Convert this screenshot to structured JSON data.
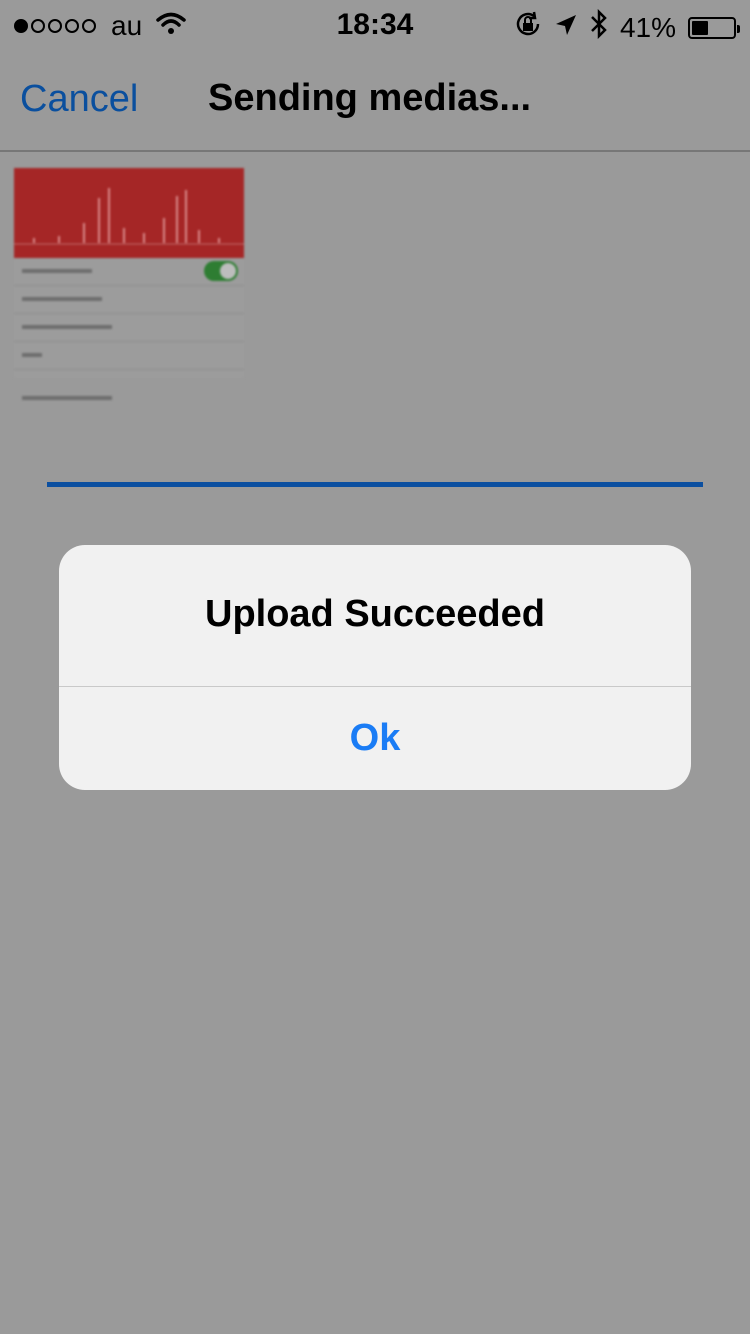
{
  "status_bar": {
    "signal_strength": 1,
    "signal_max": 5,
    "carrier": "au",
    "time": "18:34",
    "battery_percent": "41%",
    "battery_level": 0.41,
    "icons": [
      "wifi-icon",
      "rotation-lock-icon",
      "location-icon",
      "bluetooth-icon",
      "battery-icon"
    ]
  },
  "navbar": {
    "cancel_label": "Cancel",
    "title": "Sending medias..."
  },
  "upload": {
    "progress": 1.0
  },
  "alert": {
    "title": "Upload Succeeded",
    "ok_label": "Ok"
  },
  "colors": {
    "link_blue": "#0a4f9e",
    "alert_button_blue": "#1a7cf5",
    "progress_blue": "#0b4fa0",
    "thumbnail_red": "#a52626"
  }
}
